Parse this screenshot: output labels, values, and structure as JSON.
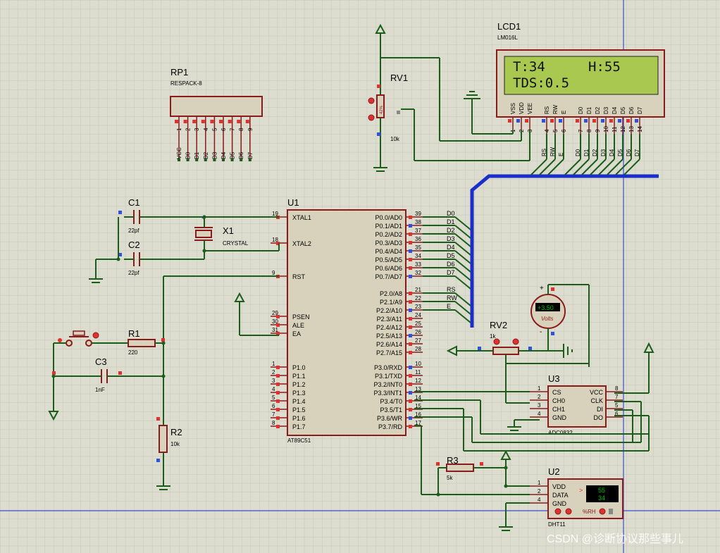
{
  "colors": {
    "background": "#dcdccf",
    "grid": "#c8c8ba",
    "wire": "#1a5e1a",
    "body_stroke": "#8b1a1a",
    "body_fill": "#d8d2bc",
    "bus": "#1a2ecc",
    "pin_red": "#e03030",
    "pin_blue": "#3050e0",
    "lcd_screen": "#a8c850",
    "display_green": "#00c000",
    "border_blue": "#2030d0"
  },
  "lcd": {
    "ref": "LCD1",
    "model": "LM016L",
    "line1_left": "T:34",
    "line1_right": "H:55",
    "line2": "TDS:0.5",
    "pin_labels": [
      "VSS",
      "VDD",
      "VEE",
      "RS",
      "RW",
      "E",
      "D0",
      "D1",
      "D2",
      "D3",
      "D4",
      "D5",
      "D6",
      "D7"
    ],
    "pin_numbers": [
      "1",
      "2",
      "3",
      "4",
      "5",
      "6",
      "7",
      "8",
      "9",
      "10",
      "11",
      "12",
      "13",
      "14"
    ],
    "bus_labels": [
      "RS",
      "RW",
      "E",
      "D0",
      "D1",
      "D2",
      "D3",
      "D4",
      "D5",
      "D6",
      "D7"
    ]
  },
  "rp1": {
    "ref": "RP1",
    "model": "RESPACK-8",
    "pin_numbers": [
      "1",
      "2",
      "3",
      "4",
      "5",
      "6",
      "7",
      "8",
      "9"
    ],
    "pin_labels": [
      "VCC",
      "D0",
      "D1",
      "D2",
      "D3",
      "D4",
      "D5",
      "D6",
      "D7"
    ]
  },
  "rv1": {
    "ref": "RV1",
    "value": "10k",
    "wiper": "42%"
  },
  "u1": {
    "ref": "U1",
    "model": "AT89C51",
    "left_pins": [
      {
        "num": "19",
        "name": "XTAL1"
      },
      {
        "num": "18",
        "name": "XTAL2"
      },
      {
        "num": "9",
        "name": "RST"
      },
      {
        "num": "29",
        "name": "PSEN"
      },
      {
        "num": "30",
        "name": "ALE"
      },
      {
        "num": "31",
        "name": "EA"
      },
      {
        "num": "1",
        "name": "P1.0"
      },
      {
        "num": "2",
        "name": "P1.1"
      },
      {
        "num": "3",
        "name": "P1.2"
      },
      {
        "num": "4",
        "name": "P1.3"
      },
      {
        "num": "5",
        "name": "P1.4"
      },
      {
        "num": "6",
        "name": "P1.5"
      },
      {
        "num": "7",
        "name": "P1.6"
      },
      {
        "num": "8",
        "name": "P1.7"
      }
    ],
    "right_pins": [
      {
        "num": "39",
        "name": "P0.0/AD0",
        "net": "D0"
      },
      {
        "num": "38",
        "name": "P0.1/AD1",
        "net": "D1"
      },
      {
        "num": "37",
        "name": "P0.2/AD2",
        "net": "D2"
      },
      {
        "num": "36",
        "name": "P0.3/AD3",
        "net": "D3"
      },
      {
        "num": "35",
        "name": "P0.4/AD4",
        "net": "D4"
      },
      {
        "num": "34",
        "name": "P0.5/AD5",
        "net": "D5"
      },
      {
        "num": "33",
        "name": "P0.6/AD6",
        "net": "D6"
      },
      {
        "num": "32",
        "name": "P0.7/AD7",
        "net": "D7"
      },
      {
        "num": "21",
        "name": "P2.0/A8",
        "net": "RS"
      },
      {
        "num": "22",
        "name": "P2.1/A9",
        "net": "RW"
      },
      {
        "num": "23",
        "name": "P2.2/A10",
        "net": "E"
      },
      {
        "num": "24",
        "name": "P2.3/A11",
        "net": ""
      },
      {
        "num": "25",
        "name": "P2.4/A12",
        "net": ""
      },
      {
        "num": "26",
        "name": "P2.5/A13",
        "net": ""
      },
      {
        "num": "27",
        "name": "P2.6/A14",
        "net": ""
      },
      {
        "num": "28",
        "name": "P2.7/A15",
        "net": ""
      },
      {
        "num": "10",
        "name": "P3.0/RXD",
        "net": ""
      },
      {
        "num": "11",
        "name": "P3.1/TXD",
        "net": ""
      },
      {
        "num": "12",
        "name": "P3.2/INT0",
        "net": ""
      },
      {
        "num": "13",
        "name": "P3.3/INT1",
        "net": ""
      },
      {
        "num": "14",
        "name": "P3.4/T0",
        "net": ""
      },
      {
        "num": "15",
        "name": "P3.5/T1",
        "net": ""
      },
      {
        "num": "16",
        "name": "P3.6/WR",
        "net": ""
      },
      {
        "num": "17",
        "name": "P3.7/RD",
        "net": ""
      }
    ]
  },
  "c1": {
    "ref": "C1",
    "value": "22pf"
  },
  "c2": {
    "ref": "C2",
    "value": "22pf"
  },
  "c3": {
    "ref": "C3",
    "value": "1nF"
  },
  "x1": {
    "ref": "X1",
    "model": "CRYSTAL"
  },
  "r1": {
    "ref": "R1",
    "value": "220"
  },
  "r2": {
    "ref": "R2",
    "value": "10k"
  },
  "r3": {
    "ref": "R3",
    "value": "5k"
  },
  "rv2": {
    "ref": "RV2",
    "value": "1k"
  },
  "voltmeter": {
    "reading": "+3.50",
    "unit": "Volts",
    "plus": "+",
    "minus": "-"
  },
  "u3": {
    "ref": "U3",
    "model": "ADC0832",
    "left_pins": [
      {
        "num": "1",
        "name": "CS"
      },
      {
        "num": "2",
        "name": "CH0"
      },
      {
        "num": "3",
        "name": "CH1"
      },
      {
        "num": "4",
        "name": "GND"
      }
    ],
    "right_pins": [
      {
        "num": "8",
        "name": "VCC"
      },
      {
        "num": "7",
        "name": "CLK"
      },
      {
        "num": "5",
        "name": "DI"
      },
      {
        "num": "6",
        "name": "DO"
      }
    ]
  },
  "u2": {
    "ref": "U2",
    "model": "DHT11",
    "pins": [
      {
        "num": "1",
        "name": "VDD"
      },
      {
        "num": "2",
        "name": "DATA"
      },
      {
        "num": "4",
        "name": "GND"
      }
    ],
    "display_top": "55",
    "display_bottom": "34",
    "arrow": ">",
    "rh_label": "%RH"
  },
  "watermark": "CSDN @诊断协议那些事儿"
}
